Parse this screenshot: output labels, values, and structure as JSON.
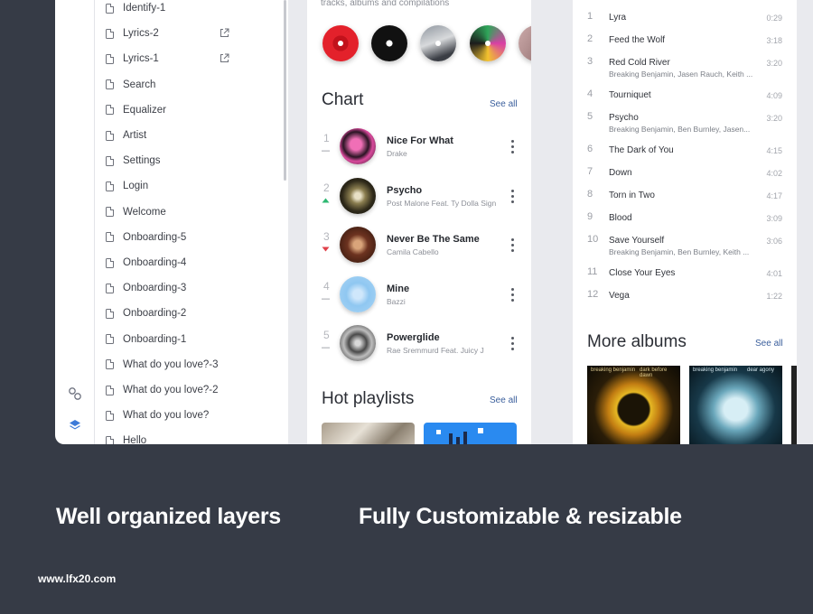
{
  "layers": {
    "items": [
      {
        "label": "Identify-1",
        "external": false
      },
      {
        "label": "Lyrics-2",
        "external": true
      },
      {
        "label": "Lyrics-1",
        "external": true
      },
      {
        "label": "Search",
        "external": false
      },
      {
        "label": "Equalizer",
        "external": false
      },
      {
        "label": "Artist",
        "external": false
      },
      {
        "label": "Settings",
        "external": false
      },
      {
        "label": "Login",
        "external": false
      },
      {
        "label": "Welcome",
        "external": false
      },
      {
        "label": "Onboarding-5",
        "external": false
      },
      {
        "label": "Onboarding-4",
        "external": false
      },
      {
        "label": "Onboarding-3",
        "external": false
      },
      {
        "label": "Onboarding-2",
        "external": false
      },
      {
        "label": "Onboarding-1",
        "external": false
      },
      {
        "label": "What do you love?-3",
        "external": false
      },
      {
        "label": "What do you love?-2",
        "external": false
      },
      {
        "label": "What do you love?",
        "external": false
      },
      {
        "label": "Hello",
        "external": false
      }
    ],
    "toolbar": {
      "components_icon": "components-icon",
      "layers_icon": "layers-icon"
    },
    "accent": "#3d7bd8"
  },
  "home": {
    "subtitle": "tracks, albums and compilations",
    "chart": {
      "title": "Chart",
      "see_all": "See all",
      "rows": [
        {
          "rank": "1",
          "title": "Nice For What",
          "artist": "Drake",
          "trend": "same"
        },
        {
          "rank": "2",
          "title": "Psycho",
          "artist": "Post Malone Feat. Ty Dolla Sign",
          "trend": "up"
        },
        {
          "rank": "3",
          "title": "Never Be The Same",
          "artist": "Camila Cabello",
          "trend": "down"
        },
        {
          "rank": "4",
          "title": "Mine",
          "artist": "Bazzi",
          "trend": "same"
        },
        {
          "rank": "5",
          "title": "Powerglide",
          "artist": "Rae Sremmurd Feat. Juicy J",
          "trend": "same"
        }
      ]
    },
    "playlists": {
      "title": "Hot playlists",
      "see_all": "See all"
    },
    "colors": {
      "up": "#2eb872",
      "down": "#e0404a",
      "same": "#b9bbc0"
    }
  },
  "album": {
    "tracks": [
      {
        "num": "1",
        "name": "Lyra",
        "sub": "",
        "dur": "0:29"
      },
      {
        "num": "2",
        "name": "Feed the Wolf",
        "sub": "",
        "dur": "3:18"
      },
      {
        "num": "3",
        "name": "Red Cold River",
        "sub": "Breaking Benjamin, Jasen Rauch, Keith ...",
        "dur": "3:20"
      },
      {
        "num": "4",
        "name": "Tourniquet",
        "sub": "",
        "dur": "4:09"
      },
      {
        "num": "5",
        "name": "Psycho",
        "sub": "Breaking Benjamin, Ben Burnley, Jasen...",
        "dur": "3:20"
      },
      {
        "num": "6",
        "name": "The Dark of You",
        "sub": "",
        "dur": "4:15"
      },
      {
        "num": "7",
        "name": "Down",
        "sub": "",
        "dur": "4:02"
      },
      {
        "num": "8",
        "name": "Torn in Two",
        "sub": "",
        "dur": "4:17"
      },
      {
        "num": "9",
        "name": "Blood",
        "sub": "",
        "dur": "3:09"
      },
      {
        "num": "10",
        "name": "Save Yourself",
        "sub": "Breaking Benjamin, Ben Burnley, Keith ...",
        "dur": "3:06"
      },
      {
        "num": "11",
        "name": "Close Your Eyes",
        "sub": "",
        "dur": "4:01"
      },
      {
        "num": "12",
        "name": "Vega",
        "sub": "",
        "dur": "1:22"
      }
    ],
    "more_albums": {
      "title": "More albums",
      "see_all": "See all",
      "cards": [
        {
          "band": "breaking benjamin",
          "album": "dark before dawn"
        },
        {
          "band": "breaking benjamin",
          "album": "dear agony"
        }
      ]
    }
  },
  "captions": {
    "left": "Well organized layers",
    "right": "Fully Customizable & resizable",
    "watermark": "www.lfx20.com"
  }
}
